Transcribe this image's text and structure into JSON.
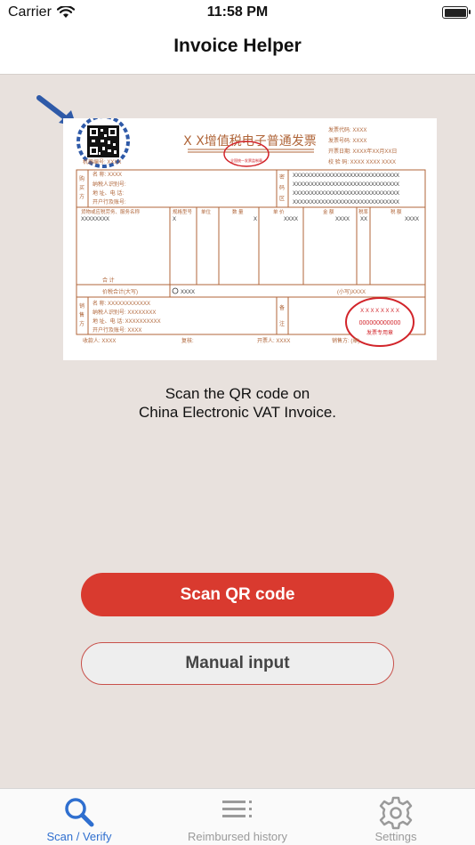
{
  "status_bar": {
    "carrier": "Carrier",
    "time": "11:58 PM"
  },
  "nav": {
    "title": "Invoice Helper"
  },
  "invoice": {
    "title": "X X增值税电子普通发票",
    "header_fields": [
      "发票代码: XXXX",
      "发票号码: XXXX",
      "开票日期: XXXX年XX月XX日",
      "校 验 码: XXXX XXXX XXXX"
    ],
    "machine_no": "机器编号: XXXX",
    "buyer_label": "购买方",
    "buyer_fields": [
      "名      称:  XXXX",
      "纳税人识别号:",
      "地 址、电 话:",
      "开户行及账号:"
    ],
    "cipher_label": "密码区",
    "cipher_rows": [
      "XXXXXXXXXXXXXXXXXXXXXXXXXXXXXX",
      "XXXXXXXXXXXXXXXXXXXXXXXXXXXXXX",
      "XXXXXXXXXXXXXXXXXXXXXXXXXXXXXX",
      "XXXXXXXXXXXXXXXXXXXXXXXXXXXXXX"
    ],
    "item_headers": [
      "货物或应税劳务、服务名称",
      "规格型号",
      "单位",
      "数 量",
      "单 价",
      "金 额",
      "税率",
      "税 额"
    ],
    "item_row": [
      "XXXXXXXX",
      "X",
      "",
      "X",
      "XXXX",
      "XXXX",
      "XX",
      "XXXX"
    ],
    "total_label": "合      计",
    "amount_label": "价税合计(大写)",
    "amount_value": "XXXX",
    "amount_small": "(小写)XXXX",
    "seller_label": "销售方",
    "seller_fields": [
      "名      称:  XXXXXXXXXXXX",
      "纳税人识别号:  XXXXXXXX",
      "地 址、电 话:  XXXXXXXXXX",
      "开户行及账号:  XXXX"
    ],
    "remark_label": "备注",
    "seal_number": "000000000000",
    "seal_text": "发票专用章",
    "seal_arc": "X X X X X X X X",
    "footer": [
      "收款人: XXXX",
      "复核:",
      "开票人: XXXX",
      "销售方: (章)"
    ]
  },
  "caption": {
    "line1": "Scan the QR code on",
    "line2": "China Electronic VAT Invoice."
  },
  "actions": {
    "scan_label": "Scan QR code",
    "manual_label": "Manual input"
  },
  "tabs": [
    {
      "label": "Scan / Verify",
      "icon": "magnifier-icon"
    },
    {
      "label": "Reimbursed history",
      "icon": "list-icon"
    },
    {
      "label": "Settings",
      "icon": "gear-icon"
    }
  ],
  "colors": {
    "accent": "#2f6fcf",
    "primary": "#d93a2f",
    "invoice_line": "#b0663a",
    "seal": "#d2242a",
    "background": "#e8e1dd"
  }
}
